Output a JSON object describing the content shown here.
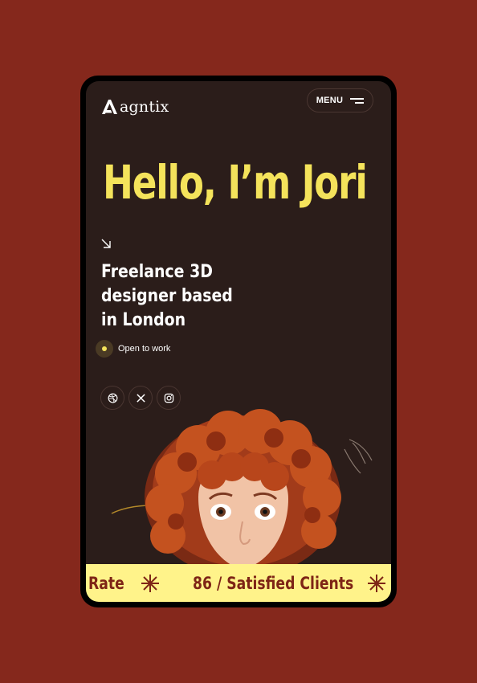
{
  "brand": {
    "name": "agntix"
  },
  "header": {
    "menu_label": "MENU"
  },
  "hero": {
    "title": "Hello, I’m Jori",
    "subtitle_lines": [
      "Freelance 3D",
      "designer based",
      "in London"
    ],
    "status": "Open to work"
  },
  "socials": [
    {
      "name": "dribbble",
      "icon": "dribbble-icon"
    },
    {
      "name": "x",
      "icon": "x-icon"
    },
    {
      "name": "instagram",
      "icon": "instagram-icon"
    }
  ],
  "ticker": {
    "items": [
      "Rate",
      "86 / Satisfied Clients"
    ]
  },
  "colors": {
    "page_bg": "#85281c",
    "screen_bg": "#2b1d1a",
    "accent_yellow": "#f4e35b",
    "ticker_bg": "#fff38a",
    "ticker_text": "#7e2516"
  }
}
